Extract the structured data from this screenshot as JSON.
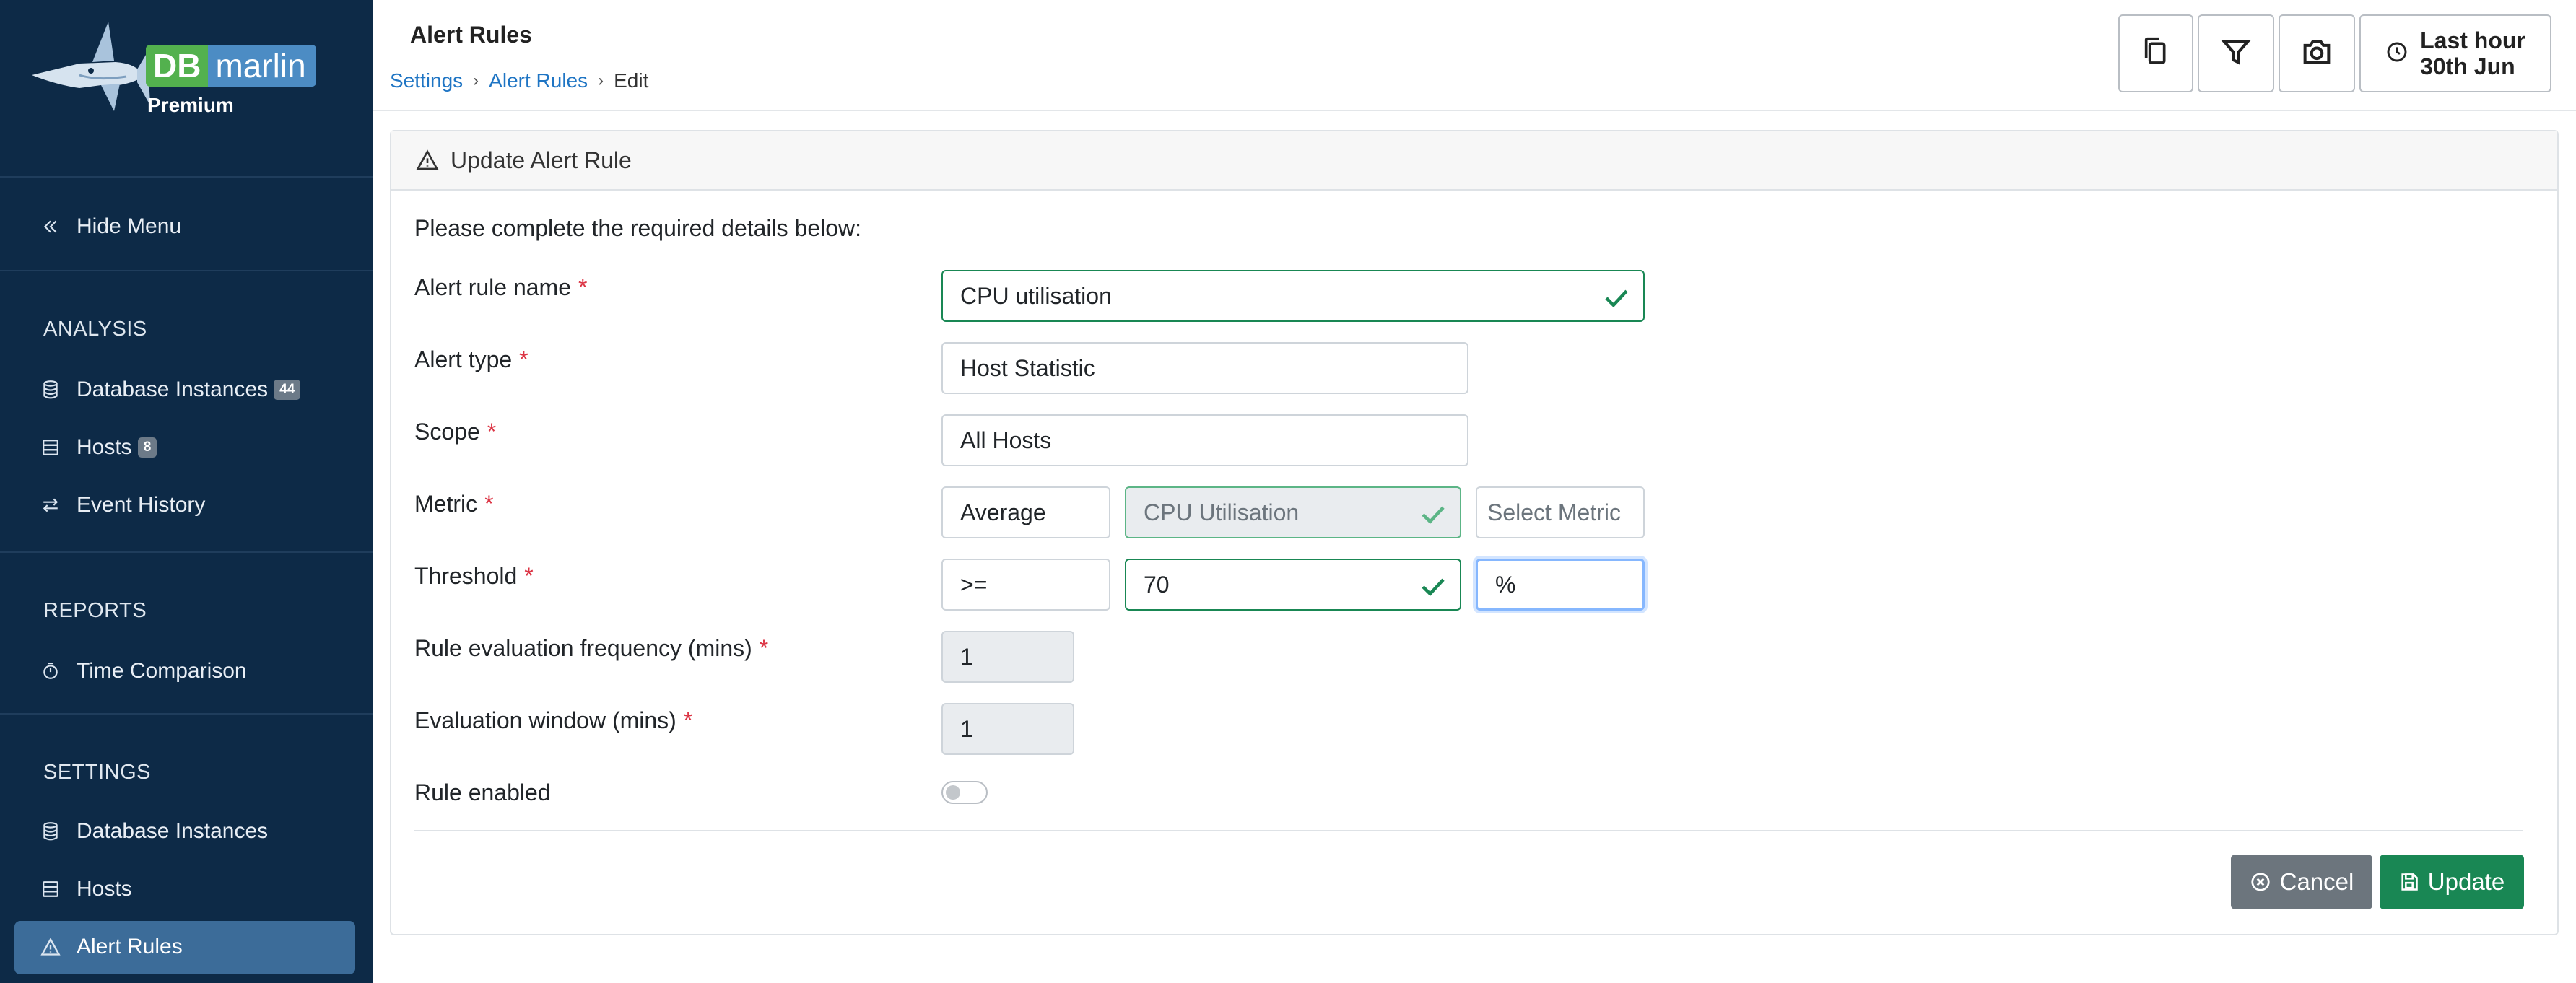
{
  "brand": {
    "db": "DB",
    "marlin": "marlin",
    "edition": "Premium"
  },
  "sidebar": {
    "hide_menu": "Hide Menu",
    "analysis": {
      "title": "ANALYSIS",
      "items": [
        {
          "label": "Database Instances",
          "badge": "44"
        },
        {
          "label": "Hosts",
          "badge": "8"
        },
        {
          "label": "Event History"
        }
      ]
    },
    "reports": {
      "title": "REPORTS",
      "items": [
        {
          "label": "Time Comparison"
        }
      ]
    },
    "settings": {
      "title": "SETTINGS",
      "items": [
        {
          "label": "Database Instances"
        },
        {
          "label": "Hosts"
        },
        {
          "label": "Alert Rules",
          "active": true
        }
      ]
    }
  },
  "header": {
    "title": "Alert Rules",
    "breadcrumb": [
      "Settings",
      "Alert Rules",
      "Edit"
    ],
    "time_range": {
      "line1": "Last hour",
      "line2": "30th Jun"
    }
  },
  "card": {
    "title": "Update Alert Rule",
    "intro": "Please complete the required details below:",
    "fields": {
      "name": {
        "label": "Alert rule name",
        "value": "CPU utilisation"
      },
      "type": {
        "label": "Alert type",
        "value": "Host Statistic"
      },
      "scope": {
        "label": "Scope",
        "value": "All Hosts"
      },
      "metric": {
        "label": "Metric",
        "aggregate": "Average",
        "metric_value": "CPU Utilisation",
        "placeholder": "Select Metric"
      },
      "threshold": {
        "label": "Threshold",
        "operator": ">=",
        "value": "70",
        "unit": "%"
      },
      "frequency": {
        "label": "Rule evaluation frequency (mins)",
        "value": "1"
      },
      "window": {
        "label": "Evaluation window (mins)",
        "value": "1"
      },
      "enabled": {
        "label": "Rule enabled",
        "value": false
      }
    },
    "required_mark": "*",
    "cancel_label": "Cancel",
    "update_label": "Update"
  },
  "colors": {
    "sidebar_bg": "#0d2a47",
    "active_bg": "#3c6c99",
    "valid": "#198754",
    "link": "#1f75c4",
    "required": "#dc3545"
  }
}
